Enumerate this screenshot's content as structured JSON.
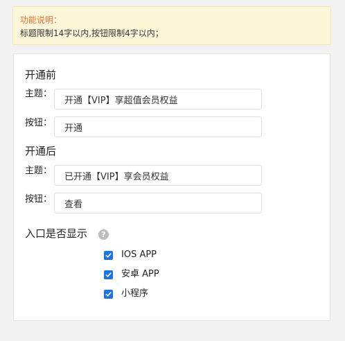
{
  "notice": {
    "title": "功能说明：",
    "text": "标题限制14字以内,按钮限制4字以内；"
  },
  "before": {
    "section_title": "开通前",
    "topic_label": "主题：",
    "topic_value": "开通【VIP】享超值会员权益",
    "button_label": "按钮：",
    "button_value": "开通"
  },
  "after": {
    "section_title": "开通后",
    "topic_label": "主题：",
    "topic_value": "已开通【VIP】享会员权益",
    "button_label": "按钮：",
    "button_value": "查看"
  },
  "entry": {
    "section_title": "入口是否显示",
    "help_icon": "?",
    "options": [
      {
        "label": "IOS APP",
        "checked": true
      },
      {
        "label": "安卓 APP",
        "checked": true
      },
      {
        "label": "小程序",
        "checked": true
      }
    ]
  },
  "colors": {
    "notice_title": "#e8703a",
    "notice_bg": "#fdf6d8",
    "checkbox": "#1a73e8"
  }
}
